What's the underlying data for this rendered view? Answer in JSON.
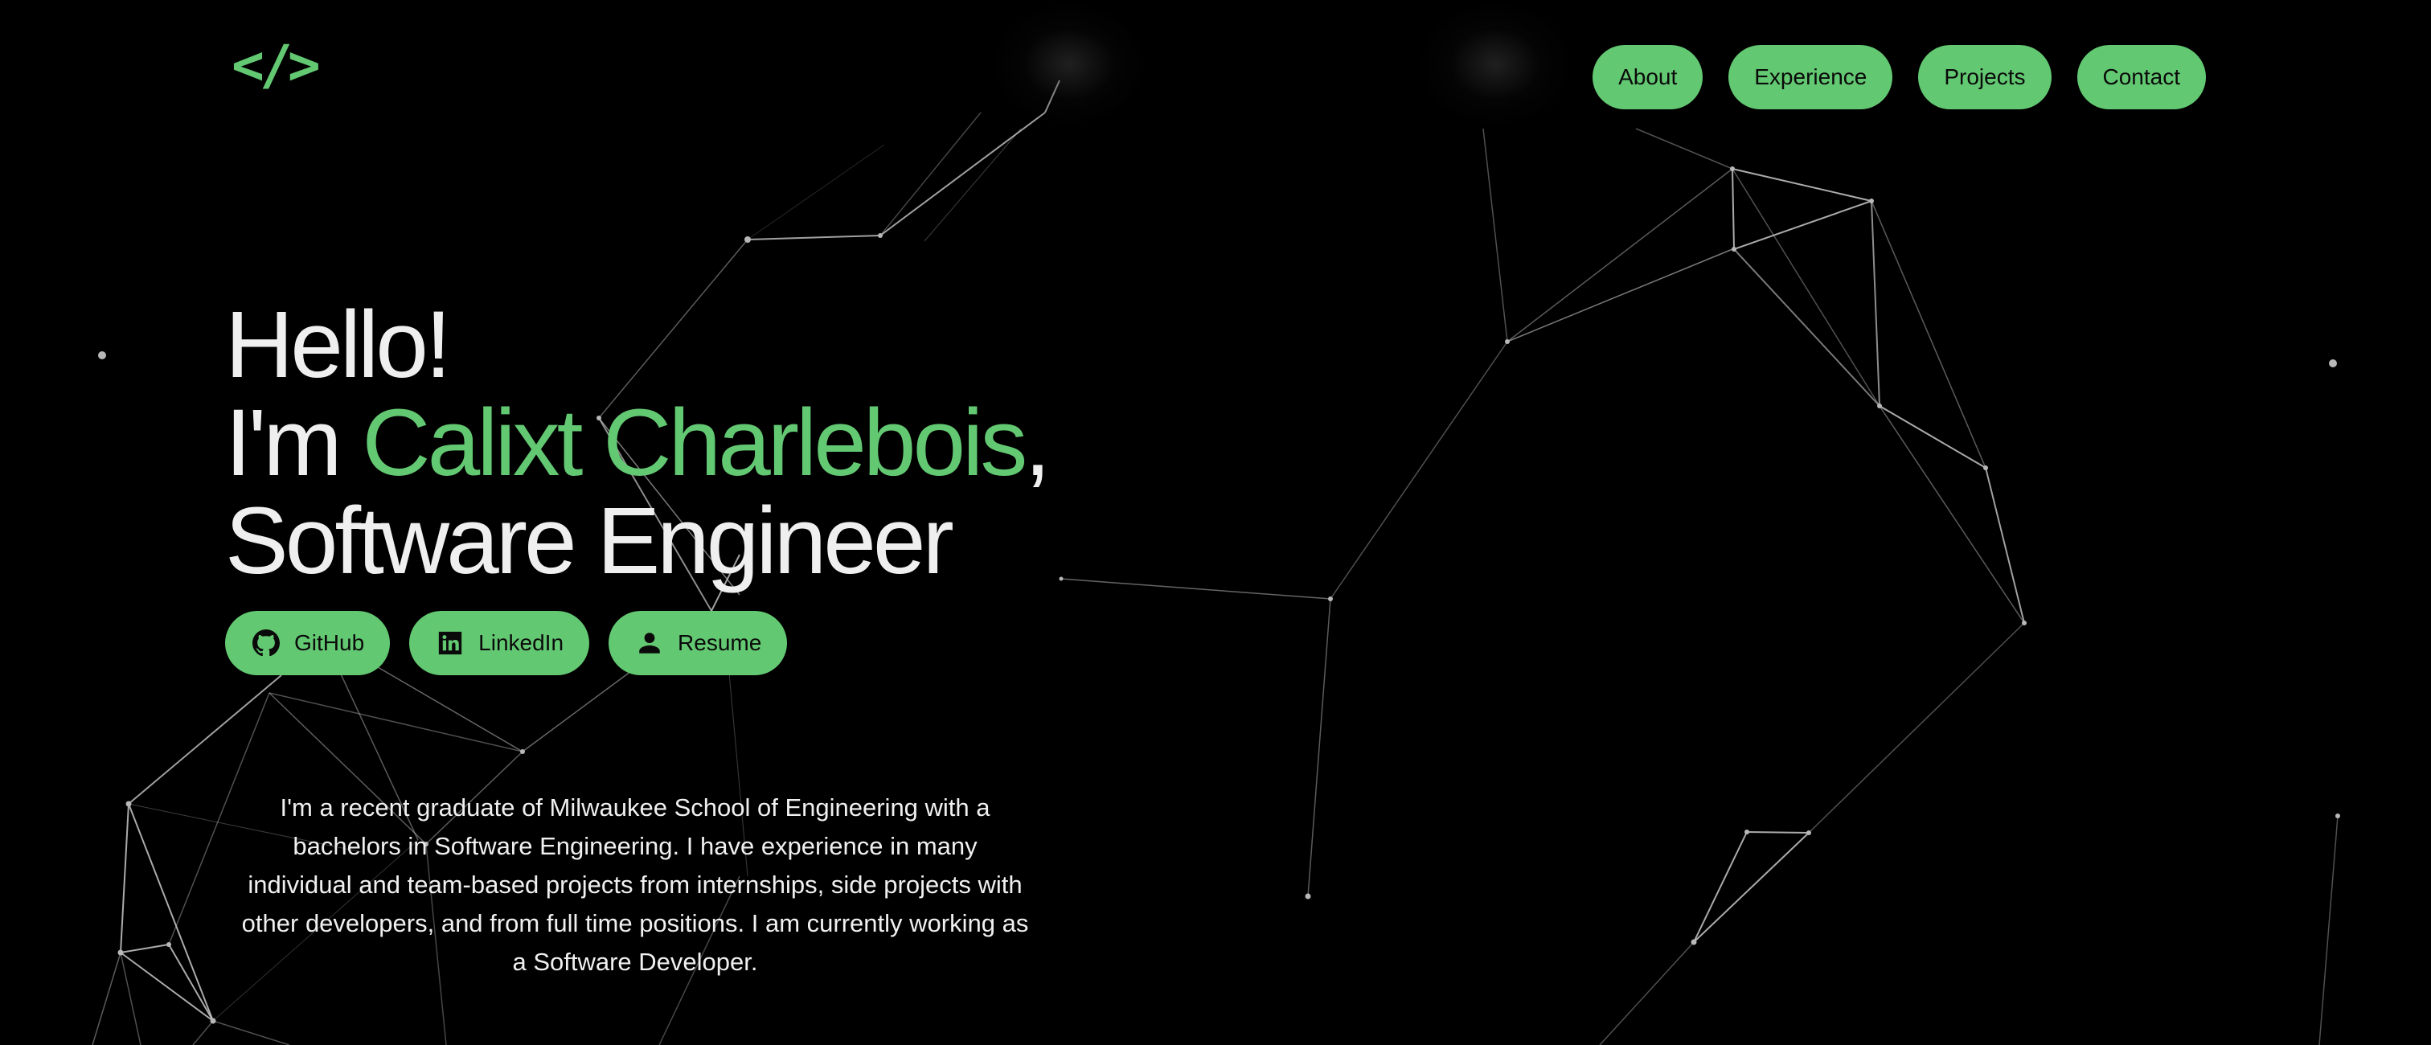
{
  "brand": {
    "logo_text": "</>",
    "accent_color": "#63c872",
    "background_color": "#000000"
  },
  "nav": {
    "items": [
      {
        "label": "About"
      },
      {
        "label": "Experience"
      },
      {
        "label": "Projects"
      },
      {
        "label": "Contact"
      }
    ]
  },
  "hero": {
    "greeting": "Hello!",
    "intro_prefix": "I'm ",
    "name": "Calixt Charlebois",
    "intro_suffix": ",",
    "role": "Software Engineer"
  },
  "social": {
    "github": {
      "label": "GitHub",
      "icon": "github-icon"
    },
    "linkedin": {
      "label": "LinkedIn",
      "icon": "linkedin-icon"
    },
    "resume": {
      "label": "Resume",
      "icon": "person-icon"
    }
  },
  "bio": {
    "text": "I'm a recent graduate of Milwaukee School of Engineering with a bachelors in Software Engineering. I have experience in many individual and team-based projects from internships, side projects with other developers, and from full time positions. I am currently working as a Software Developer."
  }
}
